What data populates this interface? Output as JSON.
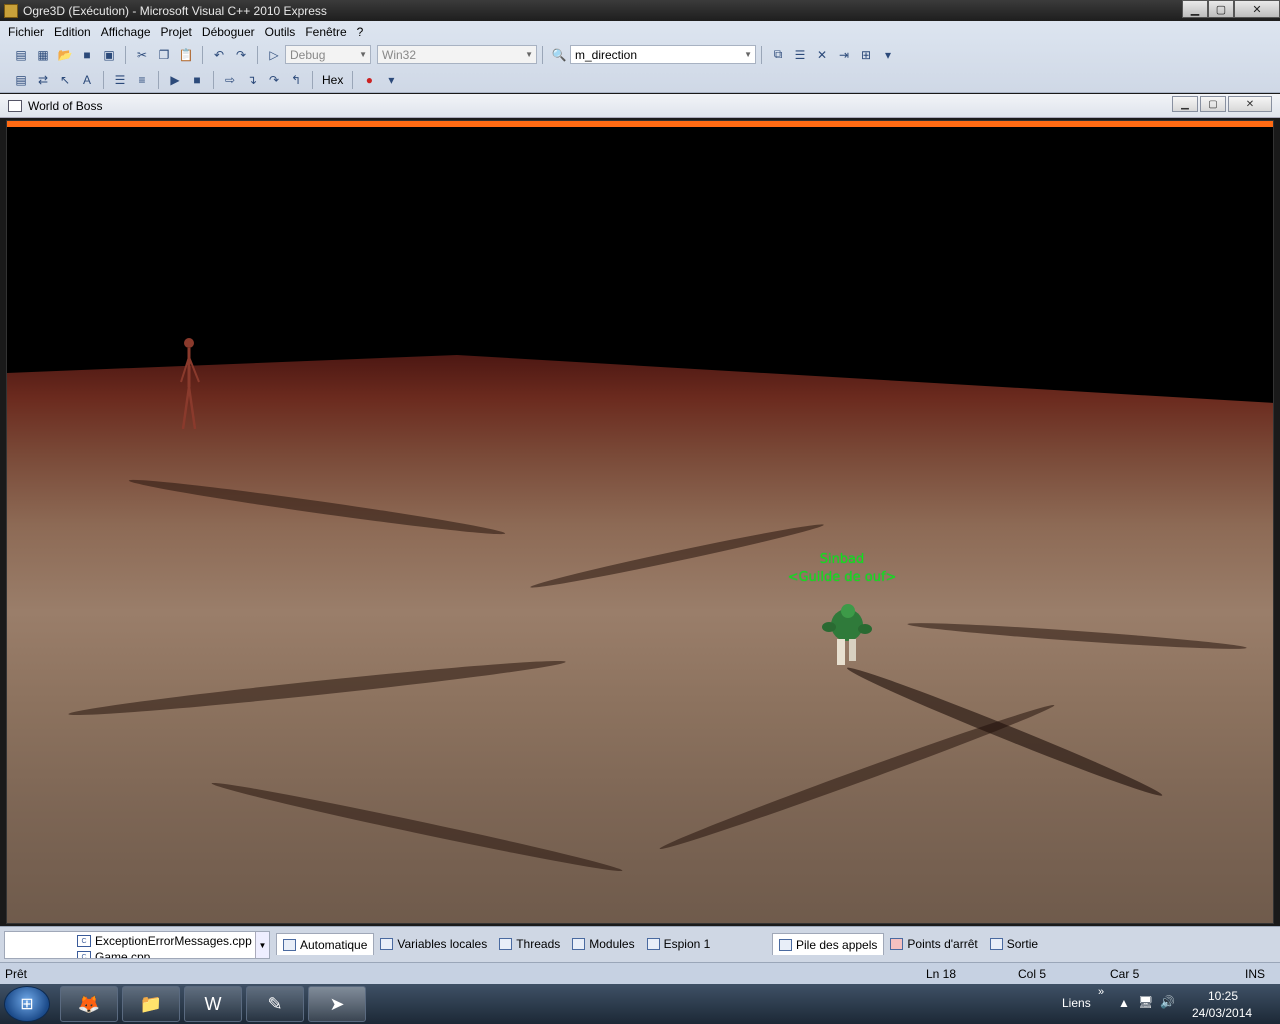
{
  "window": {
    "title": "Ogre3D (Exécution) - Microsoft Visual C++ 2010 Express",
    "min": "▁",
    "max": "▢",
    "close": "✕"
  },
  "menu": [
    "Fichier",
    "Edition",
    "Affichage",
    "Projet",
    "Déboguer",
    "Outils",
    "Fenêtre",
    "?"
  ],
  "toolbar": {
    "config": "Debug",
    "platform": "Win32",
    "find": "m_direction",
    "hex": "Hex"
  },
  "doc_window": {
    "title": "World of Boss"
  },
  "game": {
    "player_name": "Sinbad",
    "player_guild": "<Guilde de ouf>"
  },
  "files": {
    "items": [
      "ExceptionErrorMessages.cpp",
      "Game.cpp"
    ],
    "icon": "cpp-file-icon"
  },
  "tabs_left": [
    "Automatique",
    "Variables locales",
    "Threads",
    "Modules",
    "Espion 1"
  ],
  "tabs_right": [
    "Pile des appels",
    "Points d'arrêt",
    "Sortie"
  ],
  "status": {
    "state": "Prêt",
    "line": "Ln 18",
    "col": "Col 5",
    "char": "Car 5",
    "mode": "INS"
  },
  "taskbar": {
    "links": "Liens",
    "chevron": "»",
    "time": "10:25",
    "date": "24/03/2014"
  }
}
